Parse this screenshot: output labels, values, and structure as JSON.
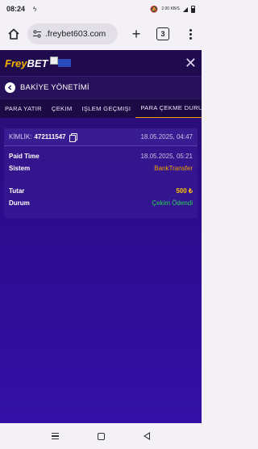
{
  "status_bar": {
    "time": "08:24",
    "network": "2.00 KB/S"
  },
  "browser": {
    "url": "freybet603.com",
    "url_prefix": ".",
    "tab_count": "3"
  },
  "site": {
    "logo_part1": "Frey",
    "logo_part2": "BET"
  },
  "title_bar": {
    "title": "BAKİYE YÖNETİMİ"
  },
  "tabs": [
    {
      "label": "PARA YATIR"
    },
    {
      "label": "ÇEKIM"
    },
    {
      "label": "IŞLEM GEÇMIŞI"
    },
    {
      "label": "PARA ÇEKME DURUM"
    }
  ],
  "card": {
    "kimlik_label": "KİMLİK:",
    "kimlik_value": "472111547",
    "created": "18.05.2025, 04:47",
    "rows": [
      {
        "label": "Paid Time",
        "value": "18.05.2025, 05:21"
      },
      {
        "label": "Sistem",
        "value": "BankTransfer"
      },
      {
        "label": "Tutar",
        "value": "500 ₺"
      },
      {
        "label": "Durum",
        "value": "Çekim Ödendi"
      }
    ]
  },
  "colors": {
    "accent_orange": "#f0a400",
    "status_green": "#28d15a",
    "page_bg": "#2c0c8c"
  }
}
